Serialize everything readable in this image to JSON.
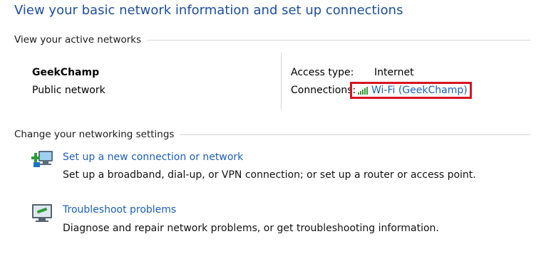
{
  "page_title": "View your basic network information and set up connections",
  "active_networks": {
    "header": "View your active networks",
    "network_name": "GeekChamp",
    "network_type": "Public network",
    "access_type_label": "Access type:",
    "access_type_value": "Internet",
    "connections_label": "Connections:",
    "connection_link": "Wi-Fi (GeekChamp)",
    "connection_icon": "wifi-signal-icon",
    "highlight_color": "#d7141e"
  },
  "settings": {
    "header": "Change your networking settings",
    "tasks": [
      {
        "icon": "new-connection-icon",
        "link": "Set up a new connection or network",
        "description": "Set up a broadband, dial-up, or VPN connection; or set up a router or access point."
      },
      {
        "icon": "troubleshoot-icon",
        "link": "Troubleshoot problems",
        "description": "Diagnose and repair network problems, or get troubleshooting information."
      }
    ]
  },
  "colors": {
    "title": "#1e4e9e",
    "link": "#1c5fb8",
    "signal": "#3a9a3a"
  }
}
